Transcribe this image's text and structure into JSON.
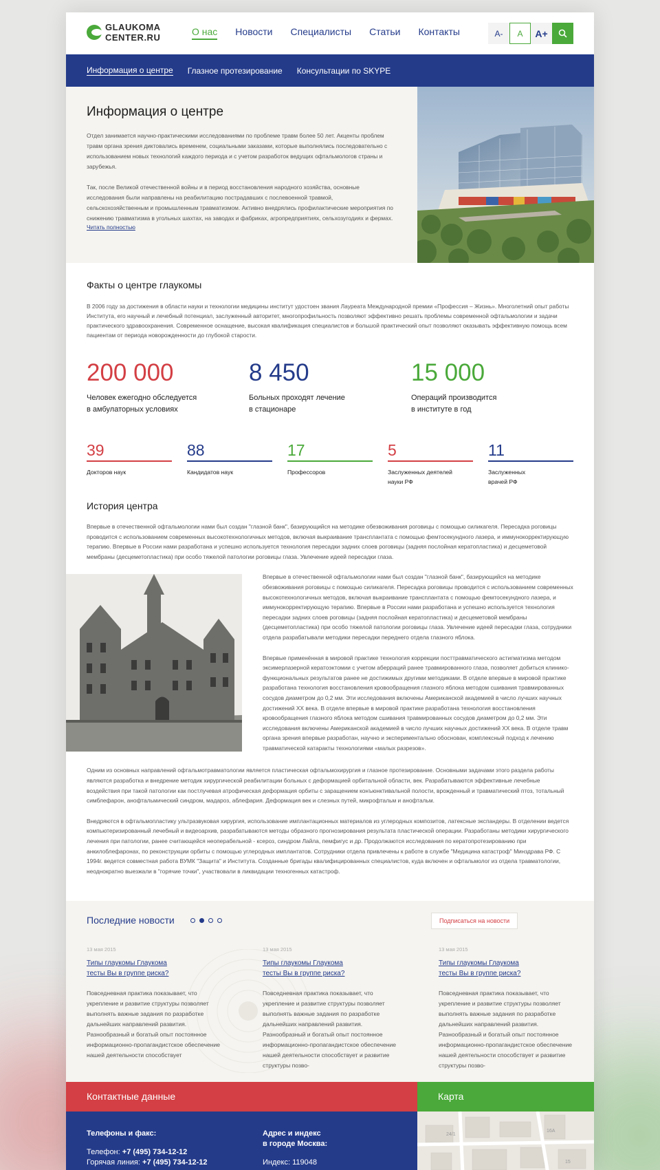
{
  "header": {
    "logo_line1": "GLAUKOMA",
    "logo_line2": "CENTER.RU",
    "nav": [
      "О нас",
      "Новости",
      "Специалисты",
      "Статьи",
      "Контакты"
    ],
    "font_small": "A-",
    "font_normal": "A",
    "font_large": "A+"
  },
  "subnav": [
    "Информация о центре",
    "Глазное протезирование",
    "Консультации по SKYPE"
  ],
  "hero": {
    "title": "Информация о центре",
    "p1": "Отдел занимается научно-практическими исследованиями по проблеме травм более 50 лет. Акценты проблем травм органа зрения диктовались временем, социальными заказами, которые выполнялись последовательно с использованием новых технологий каждого периода и с учетом разработок ведущих офтальмологов страны и зарубежья.",
    "p2": "Так, после Великой отечественной войны и в период восстановления народного хозяйства, основные исследования были направлены на реабилитацию пострадавших с послевоенной травмой, сельскохозяйственным и промышленным травматизмом. Активно внедрялись профилактические мероприятия по снижению травматизма в угольных шахтах, на заводах и фабриках, агропредприятиях, сельхозугодиях и фермах.",
    "more": "Читать полностью"
  },
  "facts": {
    "title": "Факты о центре глаукомы",
    "text": "В 2006 году за достижения в области науки и технологии медицины институт удостоен звания Лауреата Международной премии «Профессия – Жизнь». Многолетний опыт работы Института, его научный и лечебный потенциал, заслуженный авторитет, многопрофильность позволяют эффективно решать проблемы современной офтальмологии и задачи практического здравоохранения. Современное оснащение, высокая квалификация специалистов и большой практический опыт позволяют оказывать эффективную помощь всем пациентам от периода новорожденности до глубокой старости.",
    "stats": [
      {
        "num": "200 000",
        "line1": "Человек ежегодно обследуется",
        "line2": "в амбулаторных условиях"
      },
      {
        "num": "8 450",
        "line1": "Больных проходят лечение",
        "line2": "в стационаре"
      },
      {
        "num": "15 000",
        "line1": "Операций производится",
        "line2": "в институте в год"
      }
    ],
    "minis": [
      {
        "num": "39",
        "line1": "Докторов наук",
        "line2": ""
      },
      {
        "num": "88",
        "line1": "Кандидатов наук",
        "line2": ""
      },
      {
        "num": "17",
        "line1": "Профессоров",
        "line2": ""
      },
      {
        "num": "5",
        "line1": "Заслуженных деятелей",
        "line2": "науки РФ"
      },
      {
        "num": "11",
        "line1": "Заслуженных",
        "line2": "врачей РФ"
      }
    ]
  },
  "history": {
    "title": "История центра",
    "p1": "Впервые в отечественной офтальмологии нами был создан \"глазной банк\", базирующийся на методике обезвоживания роговицы с помощью силикагеля. Пересадка роговицы проводится с использованием современных высокотехнологичных методов, включая выкраивание трансплантата с помощью фемтосекундного лазера, и иммунокорректирующую терапию. Впервые в России нами разработана и успешно используется технология пересадки задних слоев роговицы (задняя послойная кератопластика) и десцеметовой мембраны (десцеметопластика) при особо тяжелой патологии роговицы глаза. Увлечение идеей пересадки глаза.",
    "side1": "Впервые в отечественной офтальмологии нами был создан \"глазной банк\", базирующийся на методике обезвоживания роговицы с помощью силикагеля. Пересадка роговицы проводится с использованием современных высокотехнологичных методов, включая выкраивание трансплантата с помощью фемтосекундного лазера, и иммунокорректирующую терапию. Впервые в России нами разработана и успешно используется технология пересадки задних слоев роговицы (задняя послойная кератопластика) и десцеметовой мембраны (десцеметопластика) при особо тяжелой патологии роговицы глаза. Увлечение идеей пересадки глаза, сотрудники отдела разрабатывали методики пересадки переднего отдела глазного яблока.",
    "side2": "Впервые применённая в мировой практике технология коррекции посттравматического астигматизма методом эксимерлазерной кератоэктомии с учетом аберраций ранее травмированного глаза, позволяет добиться клинико-функциональных результатов ранее не достижимых другими методиками. В отделе впервые в мировой практике разработана технология восстановления кровообращения глазного яблока методом сшивания травмированных сосудов диаметром до 0,2 мм. Эти исследования включены Американской академией в число лучших научных достижений XX века. В отделе впервые в мировой практике разработана технология восстановления кровообращения глазного яблока методом сшивания травмированных сосудов диаметром до 0,2 мм. Эти исследования включены Американской академией в число лучших научных достижений XX века. В отделе травм органа зрения впервые разработан, научно и экспериментально обоснован, комплексный подход к лечению травматической катаракты технологиями «малых разрезов».",
    "p2": "Одним из основных направлений офтальмотравматологии является пластическая офтальмохирургия и глазное протезирование. Основными задачами этого раздела работы являются разработка и внедрение методик хирургической реабилитации больных с деформацией орбитальной области, век. Разрабатываются эффективные лечебные воздействия при такой патологии как постлучевая атрофическая деформация орбиты с заращением конъюнктивальной полости, врожденный и травматический птоз, тотальный симблефарон, анофтальмический синдром, мадароз, аблефария. Деформация век и слезных путей, микрофтальм и анофтальм.",
    "p3": "Внедряются в офтальмопластику ультразвуковая хирургия, использование имплантационных материалов из углеродных композитов, латексные экспандеры. В отделении ведется компьютеризированный лечебный и видеоархив, разрабатываются методы образного прогнозирования результата пластической операции. Разработаны методики хирургического лечения при патологии, ранее считающейся неоперабельной - ксероз, синдром Лайла, пемфигус и др. Продолжаются исследования по кератопротезированию при анкилоблефаронах, по реконструкции орбиты с помощью углеродных имплантатов. Сотрудники отдела привлечены к работе в службе \"Медицина катастроф\" Минздрава РФ. С 1994г. ведется совместная работа ВУМК \"Защита\" и Института. Созданные бригады квалифицированных специалистов, куда включен и офтальмолог из отдела травматологии, неоднократно выезжали в \"горячие точки\", участвовали в ликвидации техногенных катастроф."
  },
  "news": {
    "title": "Последние новости",
    "subscribe": "Подписаться на новости",
    "items": [
      {
        "date": "13 мая 2015",
        "title1": "Типы глаукомы Глаукома",
        "title2": "тесты Вы в группе риска?",
        "text": "Повседневная практика показывает, что укрепление и развитие структуры позволяет выполнять важные задания по разработке дальнейших направлений развития. Разнообразный и богатый опыт постоянное информационно-пропагандистское обеспечение нашей деятельности способствует"
      },
      {
        "date": "13 мая 2015",
        "title1": "Типы глаукомы Глаукома",
        "title2": "тесты Вы в группе риска?",
        "text": "Повседневная практика показывает, что укрепление и развитие структуры позволяет выполнять важные задания по разработке дальнейших направлений развития. Разнообразный и богатый опыт постоянное информационно-пропагандистское обеспечение нашей деятельности способствует и развитие структуры позво-"
      },
      {
        "date": "13 мая 2015",
        "title1": "Типы глаукомы Глаукома",
        "title2": "тесты Вы в группе риска?",
        "text": "Повседневная практика показывает, что укрепление и развитие структуры позволяет выполнять важные задания по разработке дальнейших направлений развития. Разнообразный и богатый опыт постоянное информационно-пропагандистское обеспечение нашей деятельности способствует и развитие структуры позво-"
      }
    ]
  },
  "contacts": {
    "title": "Контактные данные",
    "map_title": "Карта",
    "phones_title": "Телефоны и факс:",
    "phone_label": "Телефон:",
    "phone": "+7 (495) 734-12-12",
    "hotline_label": "Горячая линия:",
    "hotline": "+7 (495) 734-12-12",
    "address_title_1": "Адрес и индекс",
    "address_title_2": "в городе Москва:",
    "index_label": "Индекс:",
    "index": "119048",
    "map_labels": [
      "24/1",
      "16A",
      "15"
    ]
  },
  "colors": {
    "green": "#4aa93a",
    "blue": "#243b8a",
    "red": "#d33f44",
    "cream": "#f5f4f0"
  }
}
